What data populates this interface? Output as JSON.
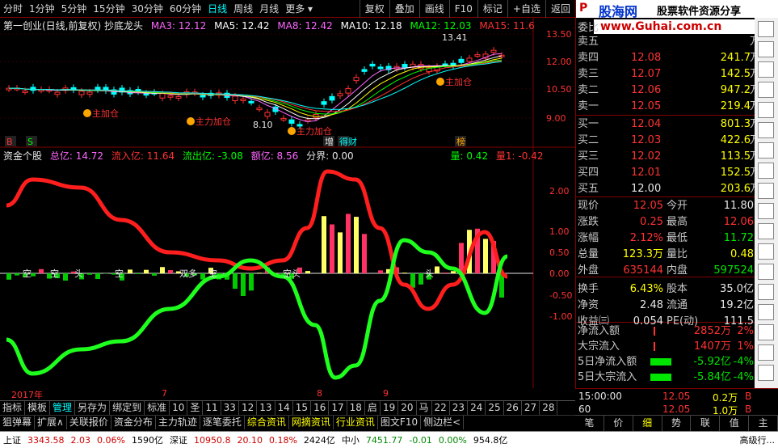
{
  "toolbar": {
    "periods": [
      "分时",
      "1分钟",
      "5分钟",
      "15分钟",
      "30分钟",
      "60分钟",
      "日线",
      "周线",
      "月线",
      "更多"
    ],
    "active_period": "日线",
    "buttons": [
      "复权",
      "叠加",
      "画线",
      "F10",
      "标记",
      "+自选",
      "返回"
    ]
  },
  "main_chart": {
    "title": "第一创业(日线,前复权) 抄底龙头",
    "ma": [
      {
        "label": "MA3: 12.12",
        "color": "#ff66ff"
      },
      {
        "label": "MA5: 12.42",
        "color": "#ffffff"
      },
      {
        "label": "MA8: 12.42",
        "color": "#ff66ff"
      },
      {
        "label": "MA10: 12.18",
        "color": "#ffffff"
      },
      {
        "label": "MA12: 12.03",
        "color": "#00ff00"
      },
      {
        "label": "MA15: 11.6",
        "color": "#ff3232"
      }
    ],
    "y_ticks": [
      "13.50",
      "12.00",
      "10.50",
      "9.00"
    ],
    "high_label": "13.41",
    "low_label": "8.10",
    "annotations": [
      "主力加仓",
      "主力加仓",
      "主加仓",
      "主加仓"
    ],
    "markers": [
      "B",
      "S",
      "增",
      "得财",
      "榜"
    ]
  },
  "sub_chart": {
    "title": "资金个股",
    "legend": [
      {
        "label": "总亿: 14.72",
        "color": "#ff66ff"
      },
      {
        "label": "流入亿: 11.64",
        "color": "#ff3232"
      },
      {
        "label": "流出亿: -3.08",
        "color": "#00ff00"
      },
      {
        "label": "额亿: 8.56",
        "color": "#ff66ff"
      },
      {
        "label": "分界: 0.00",
        "color": "#e6e6e6"
      },
      {
        "label": "量: 0.42",
        "color": "#00ff00"
      },
      {
        "label": "量1: -0.42",
        "color": "#ff3232"
      }
    ],
    "y_ticks": [
      "2.00",
      "1.00",
      "0.50",
      "0.00",
      "-0.50",
      "-1.00"
    ],
    "labels": [
      "空",
      "空",
      "头",
      "空",
      "双多",
      "空",
      "空头",
      "头"
    ]
  },
  "x_axis": {
    "labels": [
      "2017年",
      "7",
      "8",
      "9"
    ]
  },
  "bottom_tabs": [
    "指标",
    "模板",
    "管理",
    "另存为",
    "绑定到",
    "标准",
    "10",
    "圣",
    "11",
    "33",
    "12",
    "13",
    "14",
    "15",
    "16",
    "17",
    "18",
    "启",
    "19",
    "20",
    "马",
    "22",
    "23",
    "24",
    "25",
    "26",
    "27",
    "28"
  ],
  "bottom_tabs_active": "管理",
  "bottom_links": [
    "狙弹幕",
    "扩展∧",
    "关联报价",
    "资金分布",
    "主力轨迹",
    "逐笔委托",
    "综合资讯",
    "网摘资讯",
    "行业资讯",
    "图文F10",
    "侧边栏<"
  ],
  "quote": {
    "header": "P",
    "brand_name": "股海网",
    "brand_slogan": "股票软件资源分享",
    "brand_url": "www.Guhai.com.cn",
    "first_row_label": "委比",
    "asks": [
      {
        "label": "卖五",
        "price": "",
        "vol": "",
        "unit": "万"
      },
      {
        "label": "卖四",
        "price": "12.08",
        "vol": "241.7",
        "unit": "万"
      },
      {
        "label": "卖三",
        "price": "12.07",
        "vol": "142.5",
        "unit": "万"
      },
      {
        "label": "卖二",
        "price": "12.06",
        "vol": "947.2",
        "unit": "万"
      },
      {
        "label": "卖一",
        "price": "12.05",
        "vol": "219.4",
        "unit": "万"
      }
    ],
    "bids": [
      {
        "label": "买一",
        "price": "12.04",
        "vol": "801.3",
        "unit": "万"
      },
      {
        "label": "买二",
        "price": "12.03",
        "vol": "422.6",
        "unit": "万"
      },
      {
        "label": "买三",
        "price": "12.02",
        "vol": "113.5",
        "unit": "万"
      },
      {
        "label": "买四",
        "price": "12.01",
        "vol": "152.5",
        "unit": "万"
      },
      {
        "label": "买五",
        "price": "12.00",
        "vol": "203.6",
        "unit": "万"
      }
    ],
    "stats": [
      {
        "l1": "现价",
        "v1": "12.05",
        "c1": "red",
        "l2": "今开",
        "v2": "11.80",
        "c2": "white"
      },
      {
        "l1": "涨跌",
        "v1": "0.25",
        "c1": "red",
        "l2": "最高",
        "v2": "12.06",
        "c2": "red"
      },
      {
        "l1": "涨幅",
        "v1": "2.12%",
        "c1": "red",
        "l2": "最低",
        "v2": "11.72",
        "c2": "green"
      },
      {
        "l1": "总量",
        "v1": "123.3万",
        "c1": "yellow",
        "l2": "量比",
        "v2": "0.48",
        "c2": "yellow"
      },
      {
        "l1": "外盘",
        "v1": "635144",
        "c1": "red",
        "l2": "内盘",
        "v2": "597524",
        "c2": "green"
      },
      {
        "l1": "换手",
        "v1": "6.43%",
        "c1": "yellow",
        "l2": "股本",
        "v2": "35.0亿",
        "c2": "white"
      },
      {
        "l1": "净资",
        "v1": "2.48",
        "c1": "white",
        "l2": "流通",
        "v2": "19.2亿",
        "c2": "white"
      },
      {
        "l1": "收益㈢",
        "v1": "0.054",
        "c1": "white",
        "l2": "PE(动)",
        "v2": "111.5",
        "c2": "white"
      }
    ],
    "flows": [
      {
        "label": "净流入额",
        "value": "2852万",
        "pct": "2%",
        "c": "red"
      },
      {
        "label": "大宗流入",
        "value": "1407万",
        "pct": "1%",
        "c": "red"
      },
      {
        "label": "5日净流入额",
        "value": "-5.92亿",
        "pct": "-4%",
        "c": "green"
      },
      {
        "label": "5日大宗流入",
        "value": "-5.84亿",
        "pct": "-4%",
        "c": "green"
      }
    ],
    "ticks": [
      {
        "time": "15:00:00",
        "price": "12.05",
        "vol": "0.2万",
        "side": "B"
      },
      {
        "time": "60",
        "price": "12.05",
        "vol": "1.0万",
        "side": "B"
      }
    ],
    "tabs": [
      "笔",
      "价",
      "细",
      "势",
      "联",
      "值",
      "主"
    ],
    "active_tab": "细"
  },
  "status_bar": {
    "sh_label": "上证",
    "sh_value": "3343.58",
    "sh_change": "2.03",
    "sh_pct": "0.06%",
    "sh_amount": "1590亿",
    "sz_label": "深证",
    "sz_value": "10950.8",
    "sz_change": "20.10",
    "sz_pct": "0.18%",
    "sz_amount": "2424亿",
    "zx_label": "中小",
    "zx_value": "7451.77",
    "zx_change": "-0.01",
    "zx_pct": "0.00%",
    "zx_amount": "954.8亿",
    "right_text": "高级行..."
  }
}
